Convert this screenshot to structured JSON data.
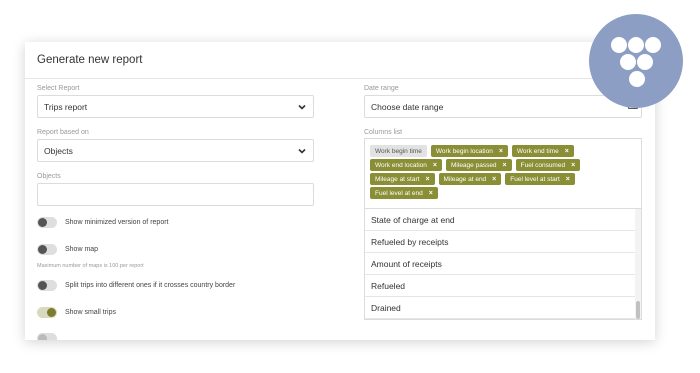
{
  "report": {
    "title": "Generate new report",
    "select_report": {
      "label": "Select Report",
      "value": "Trips report"
    },
    "based_on": {
      "label": "Report based on",
      "value": "Objects"
    },
    "objects": {
      "label": "Objects",
      "value": ""
    },
    "date_range": {
      "label": "Date range",
      "value": "Choose date range"
    },
    "columns_list": {
      "label": "Columns list"
    }
  },
  "toggles": {
    "minimized": {
      "label": "Show minimized version of report",
      "on": false
    },
    "show_map": {
      "label": "Show map",
      "on": false,
      "hint": "Maximum number of maps is 100 per report"
    },
    "split_trips": {
      "label": "Split trips into different ones if it crosses country border",
      "on": false
    },
    "small_trips": {
      "label": "Show small trips",
      "on": true
    }
  },
  "column_tags": [
    {
      "label": "Work begin time",
      "removable": false
    },
    {
      "label": "Work begin location",
      "removable": true
    },
    {
      "label": "Work end time",
      "removable": true
    },
    {
      "label": "Work end location",
      "removable": true
    },
    {
      "label": "Mileage passed",
      "removable": true
    },
    {
      "label": "Fuel consumed",
      "removable": true
    },
    {
      "label": "Mileage at start",
      "removable": true
    },
    {
      "label": "Mileage at end",
      "removable": true
    },
    {
      "label": "Fuel level at start",
      "removable": true
    },
    {
      "label": "Fuel level at end",
      "removable": true
    }
  ],
  "column_options": [
    "State of charge at end",
    "Refueled by receipts",
    "Amount of receipts",
    "Refueled",
    "Drained"
  ],
  "colors": {
    "tag": "#8a8e35",
    "toggle_on": "#7c7c2e",
    "brand": "#8d9ec4"
  },
  "icons": {
    "select": "chevron-down-icon",
    "tag_remove": "close-icon",
    "date": "calendar-icon",
    "brand": "grape-logo"
  }
}
